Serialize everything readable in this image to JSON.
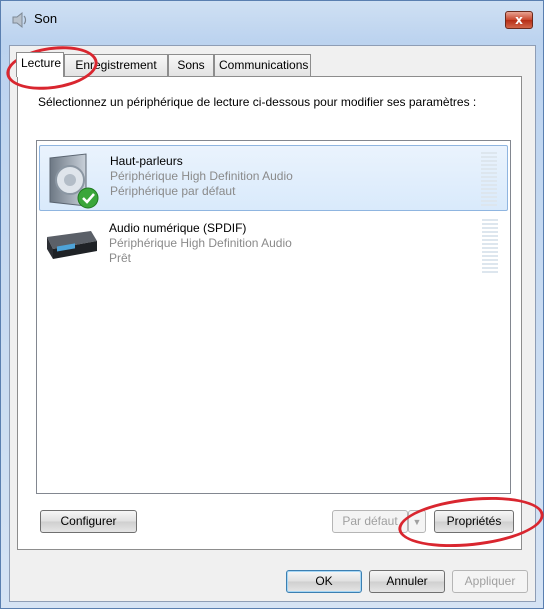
{
  "window": {
    "title": "Son",
    "close_label": "x"
  },
  "tabs": [
    {
      "label": "Lecture"
    },
    {
      "label": "Enregistrement"
    },
    {
      "label": "Sons"
    },
    {
      "label": "Communications"
    }
  ],
  "instruction": "Sélectionnez un périphérique de lecture ci-dessous pour modifier ses paramètres :",
  "devices": [
    {
      "name": "Haut-parleurs",
      "line1": "Périphérique High Definition Audio",
      "line2": "Périphérique par défaut",
      "icon": "speaker-icon",
      "status_icon": "default-check-icon",
      "selected": true
    },
    {
      "name": "Audio numérique (SPDIF)",
      "line1": "Périphérique High Definition Audio",
      "line2": "Prêt",
      "icon": "digital-audio-receiver-icon",
      "selected": false
    }
  ],
  "buttons": {
    "configure": "Configurer",
    "set_default": "Par défaut",
    "properties": "Propriétés",
    "ok": "OK",
    "cancel": "Annuler",
    "apply": "Appliquer"
  },
  "colors": {
    "selection": "#d9eafb",
    "annotation_red": "#d9262f",
    "check_green": "#3aa63a"
  }
}
